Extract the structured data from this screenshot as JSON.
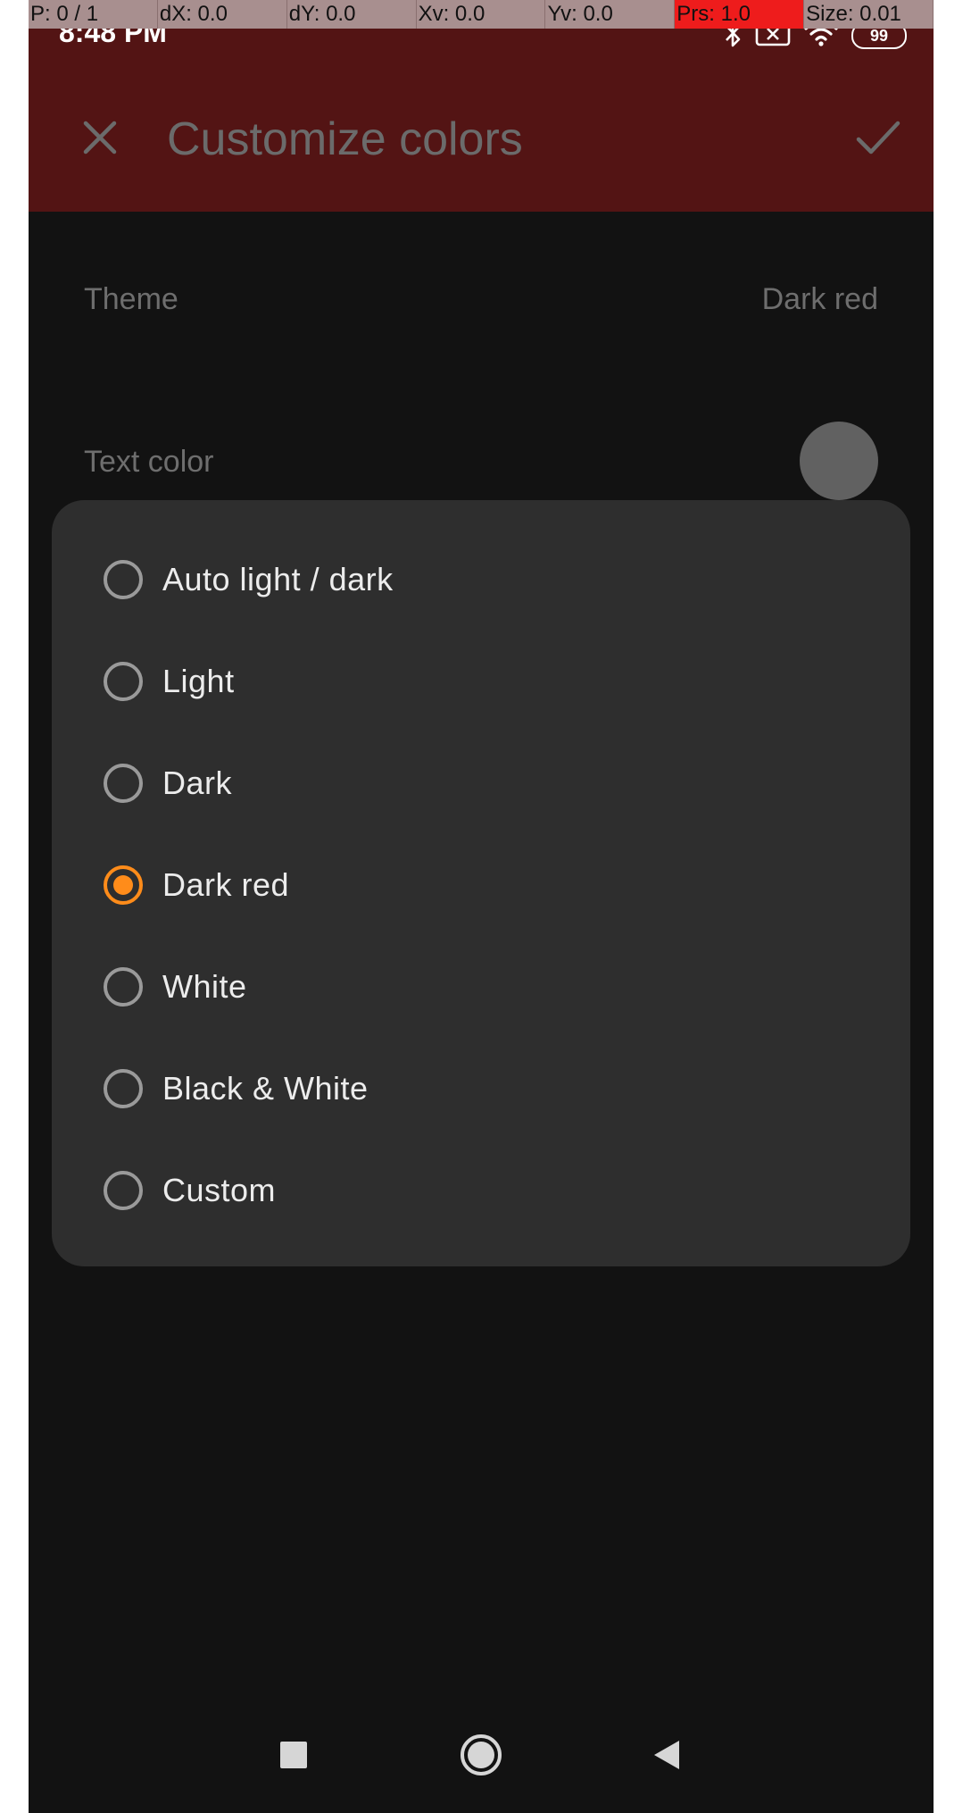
{
  "debug": {
    "pointer": "P: 0 / 1",
    "dx": "dX: 0.0",
    "dy": "dY: 0.0",
    "xv": "Xv: 0.0",
    "yv": "Yv: 0.0",
    "prs": "Prs: 1.0",
    "size": "Size: 0.01"
  },
  "status_bar": {
    "time": "8:48 PM",
    "battery": "99",
    "icons": [
      "bluetooth-icon",
      "sim-card-icon",
      "wifi-icon",
      "battery-icon"
    ]
  },
  "app_bar": {
    "title": "Customize colors",
    "close_icon": "close-icon",
    "confirm_icon": "check-icon"
  },
  "settings": {
    "theme_label": "Theme",
    "theme_value": "Dark red",
    "text_color_label": "Text color"
  },
  "dialog": {
    "options": [
      {
        "label": "Auto light / dark",
        "selected": false
      },
      {
        "label": "Light",
        "selected": false
      },
      {
        "label": "Dark",
        "selected": false
      },
      {
        "label": "Dark red",
        "selected": true
      },
      {
        "label": "White",
        "selected": false
      },
      {
        "label": "Black & White",
        "selected": false
      },
      {
        "label": "Custom",
        "selected": false
      }
    ]
  },
  "nav_bar": {
    "icons": [
      "recents-square-icon",
      "home-circle-icon",
      "back-triangle-icon"
    ]
  },
  "colors": {
    "app_bar": "#531414",
    "background": "#121212",
    "dialog": "#2e2e2e",
    "accent": "#ff8c1a"
  }
}
